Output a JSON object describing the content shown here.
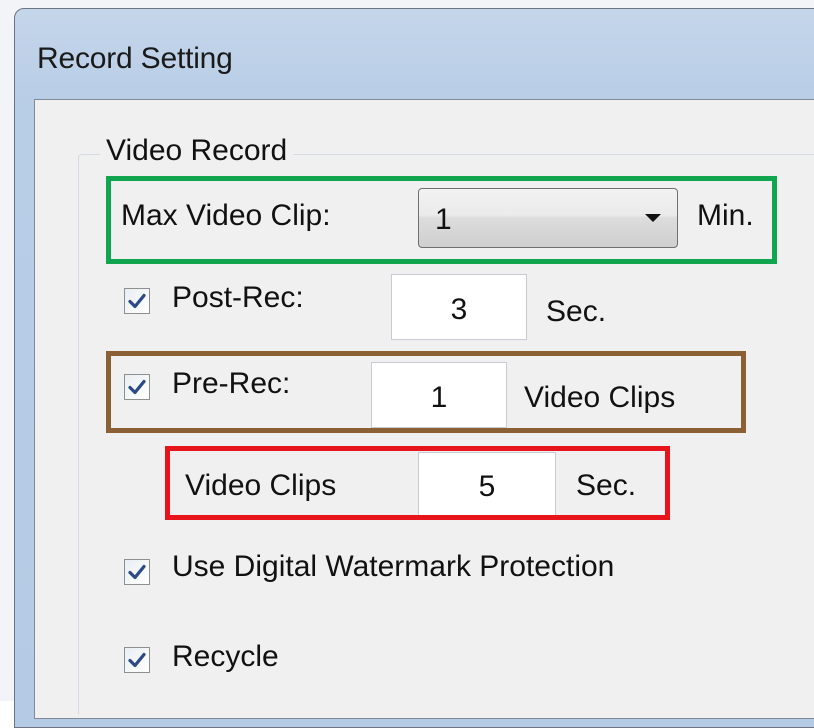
{
  "window": {
    "title": "Record Setting"
  },
  "video_record": {
    "group_title": "Video Record",
    "max_video_clip": {
      "label": "Max Video Clip:",
      "value": "1",
      "unit": "Min."
    },
    "post_rec": {
      "checked": true,
      "label": "Post-Rec:",
      "value": "3",
      "unit": "Sec."
    },
    "pre_rec": {
      "checked": true,
      "label": "Pre-Rec:",
      "value": "1",
      "unit": "Video Clips"
    },
    "video_clips": {
      "label": "Video Clips",
      "value": "5",
      "unit": "Sec."
    },
    "watermark": {
      "checked": true,
      "label": "Use Digital Watermark Protection"
    },
    "recycle": {
      "checked": true,
      "label": "Recycle"
    }
  },
  "highlight_colors": {
    "max_video_clip": "#12a550",
    "pre_rec": "#8b6035",
    "video_clips": "#e8141c"
  }
}
